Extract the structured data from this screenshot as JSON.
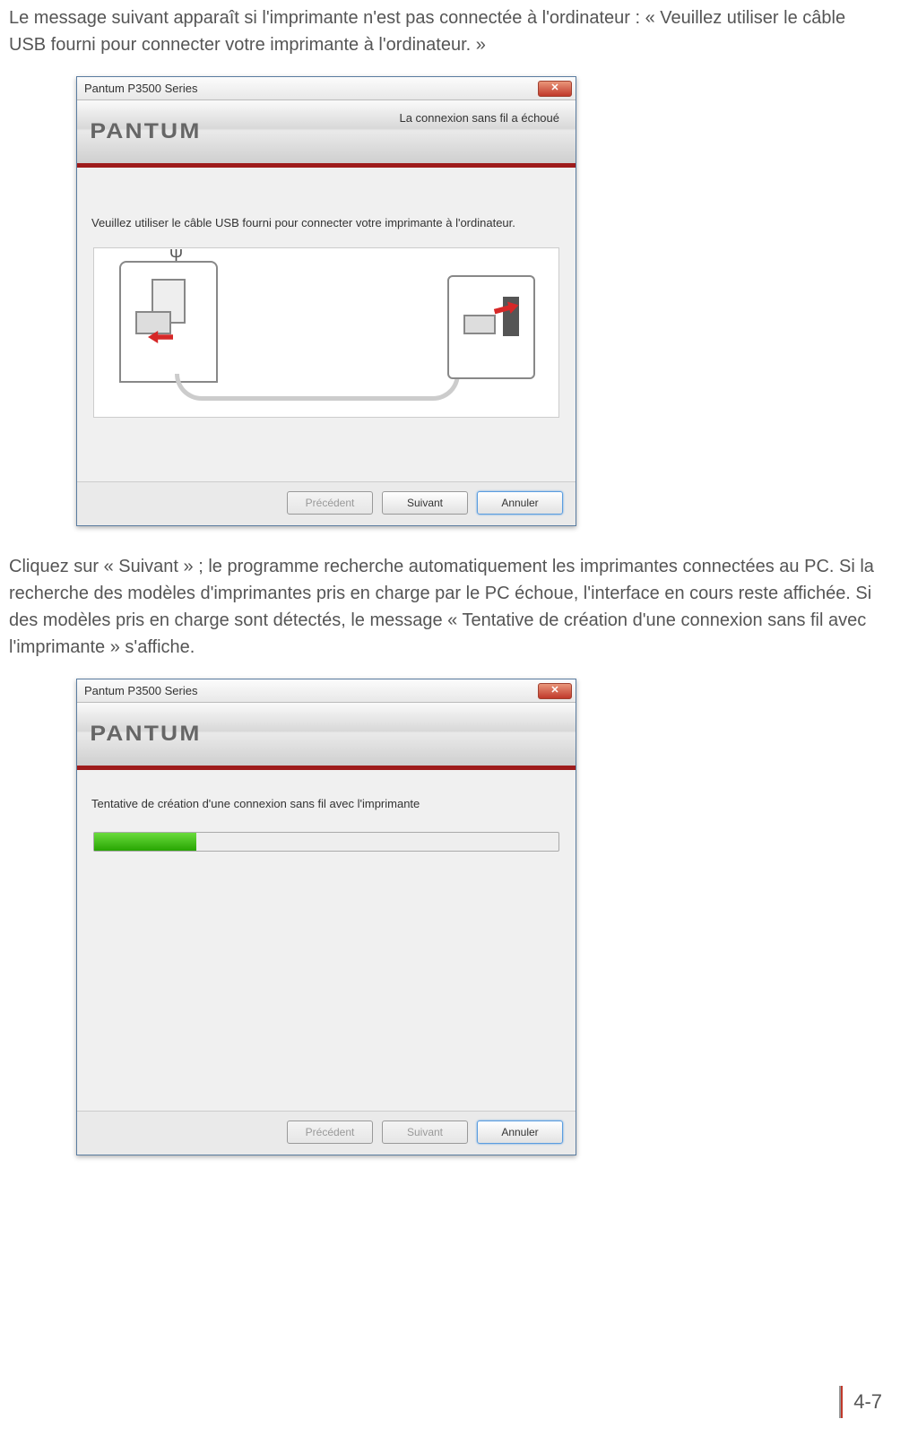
{
  "doc": {
    "para1": "Le message suivant apparaît si l'imprimante n'est pas connectée à l'ordinateur : « Veuillez utiliser le câble USB fourni pour connecter votre imprimante à l'ordinateur. »",
    "para2": "Cliquez sur « Suivant » ; le programme recherche automatiquement les imprimantes connectées au PC. Si la recherche des modèles d'imprimantes pris en charge par le PC échoue, l'interface en cours reste affichée. Si des modèles pris en charge sont détectés, le message « Tentative de création d'une connexion sans fil avec l'imprimante » s'affiche.",
    "pageNumber": "4-7"
  },
  "dialog1": {
    "title": "Pantum P3500 Series",
    "logo": "PANTUM",
    "bannerMsg": "La connexion sans fil a échoué",
    "instruct": "Veuillez utiliser le câble USB fourni pour connecter votre imprimante à l'ordinateur.",
    "buttons": {
      "prev": "Précédent",
      "next": "Suivant",
      "cancel": "Annuler"
    }
  },
  "dialog2": {
    "title": "Pantum P3500 Series",
    "logo": "PANTUM",
    "instruct": "Tentative de création d'une connexion sans fil avec l'imprimante",
    "progressPct": 22,
    "buttons": {
      "prev": "Précédent",
      "next": "Suivant",
      "cancel": "Annuler"
    }
  }
}
